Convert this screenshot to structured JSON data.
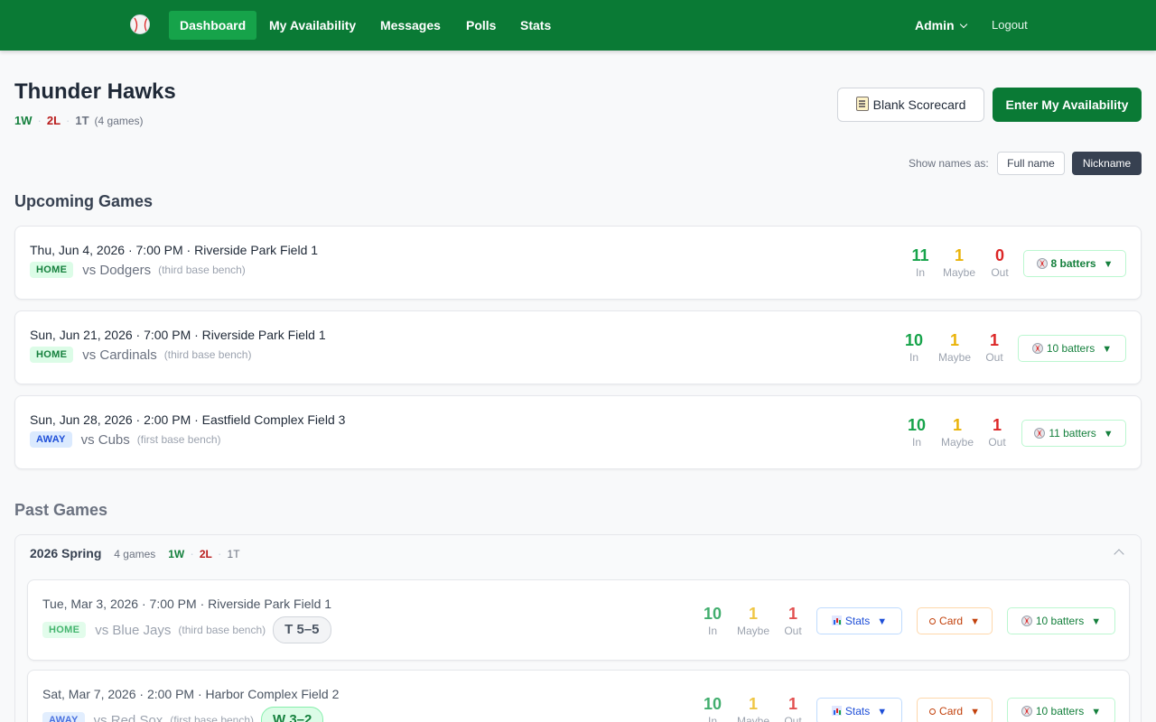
{
  "nav": {
    "logo_icon": "baseball-icon",
    "items": [
      "Dashboard",
      "My Availability",
      "Messages",
      "Polls",
      "Stats"
    ],
    "active": "Dashboard",
    "admin_label": "Admin",
    "logout_label": "Logout"
  },
  "team": {
    "name": "Thunder Hawks",
    "wins": "1W",
    "losses": "2L",
    "ties": "1T",
    "games_count": "(4 games)"
  },
  "actions": {
    "scorecard_label": "Blank Scorecard",
    "enter_label": "Enter My Availability"
  },
  "name_toggle": {
    "label": "Show names as:",
    "options": [
      "Full name",
      "Nickname"
    ],
    "selected": "Nickname"
  },
  "upcoming": {
    "title": "Upcoming Games",
    "games": [
      {
        "meta": "Thu, Jun 4, 2026 · 7:00 PM · Riverside Park Field 1",
        "side": "HOME",
        "opponent": "vs Dodgers",
        "bench": "(third base bench)",
        "in": "11",
        "maybe": "1",
        "out": "0",
        "batters": "8 batters"
      },
      {
        "meta": "Sun, Jun 21, 2026 · 7:00 PM · Riverside Park Field 1",
        "side": "HOME",
        "opponent": "vs Cardinals",
        "bench": "(third base bench)",
        "in": "10",
        "maybe": "1",
        "out": "1",
        "batters": "10 batters"
      },
      {
        "meta": "Sun, Jun 28, 2026 · 2:00 PM · Eastfield Complex Field 3",
        "side": "AWAY",
        "opponent": "vs Cubs",
        "bench": "(first base bench)",
        "in": "10",
        "maybe": "1",
        "out": "1",
        "batters": "11 batters"
      }
    ]
  },
  "labels": {
    "in": "In",
    "maybe": "Maybe",
    "out": "Out",
    "stats": "Stats",
    "card": "Card",
    "caret": "▼"
  },
  "past": {
    "title": "Past Games",
    "season": {
      "name": "2026 Spring",
      "count": "4 games",
      "wins": "1W",
      "losses": "2L",
      "ties": "1T"
    },
    "games": [
      {
        "meta": "Tue, Mar 3, 2026 · 7:00 PM · Riverside Park Field 1",
        "side": "HOME",
        "opponent": "vs Blue Jays",
        "bench": "(third base bench)",
        "result": "T 5–5",
        "in": "10",
        "maybe": "1",
        "out": "1",
        "batters": "10 batters"
      },
      {
        "meta": "Sat, Mar 7, 2026 · 2:00 PM · Harbor Complex Field 2",
        "side": "AWAY",
        "opponent": "vs Red Sox",
        "bench": "(first base bench)",
        "result": "W 3–2",
        "in": "10",
        "maybe": "1",
        "out": "1",
        "batters": "10 batters"
      }
    ]
  },
  "colors": {
    "brand": "#0a7a35",
    "in": "#16a34a",
    "maybe": "#eab308",
    "out": "#dc2626"
  }
}
